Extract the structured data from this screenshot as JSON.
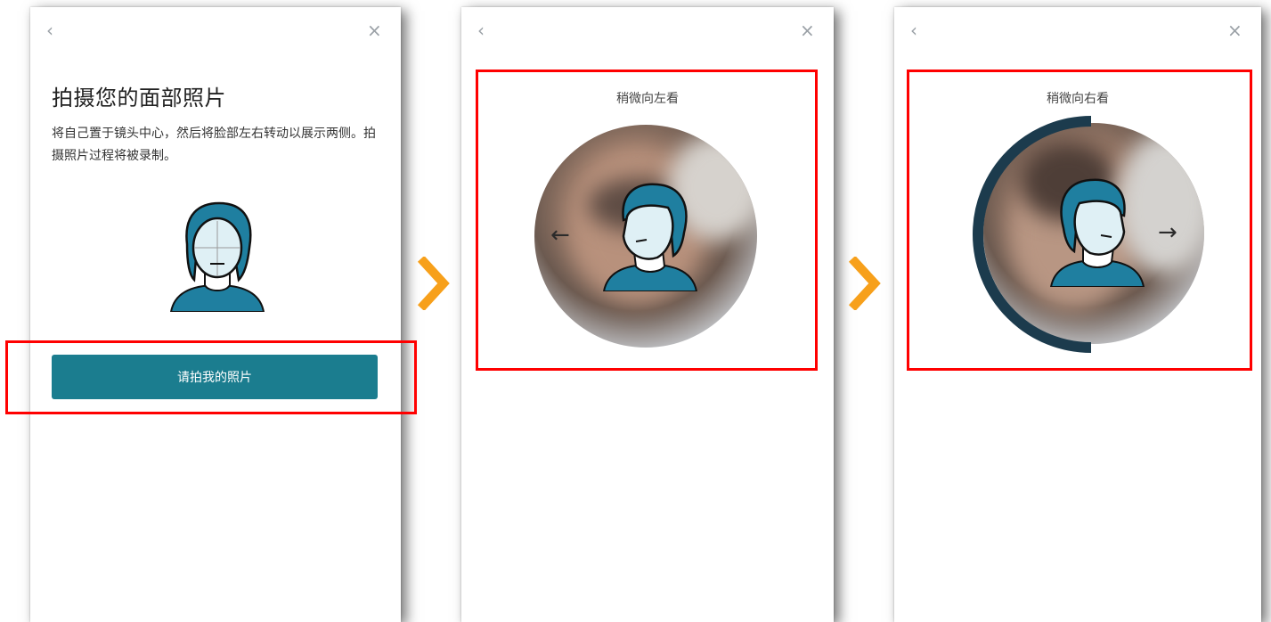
{
  "screen1": {
    "title": "拍摄您的面部照片",
    "description": "将自己置于镜头中心，然后将脸部左右转动以展示两侧。拍摄照片过程将被录制。",
    "button_label": "请拍我的照片"
  },
  "screen2": {
    "instruction": "稍微向左看"
  },
  "screen3": {
    "instruction": "稍微向右看"
  },
  "icons": {
    "back": "‹",
    "close": "×",
    "left_arrow": "←",
    "right_arrow": "→"
  },
  "colors": {
    "button": "#1b7d8f",
    "highlight": "#ff0000",
    "chevron": "#f7a01b",
    "face_blue": "#1f7fa0",
    "progress_ring": "#1c3b4d"
  }
}
